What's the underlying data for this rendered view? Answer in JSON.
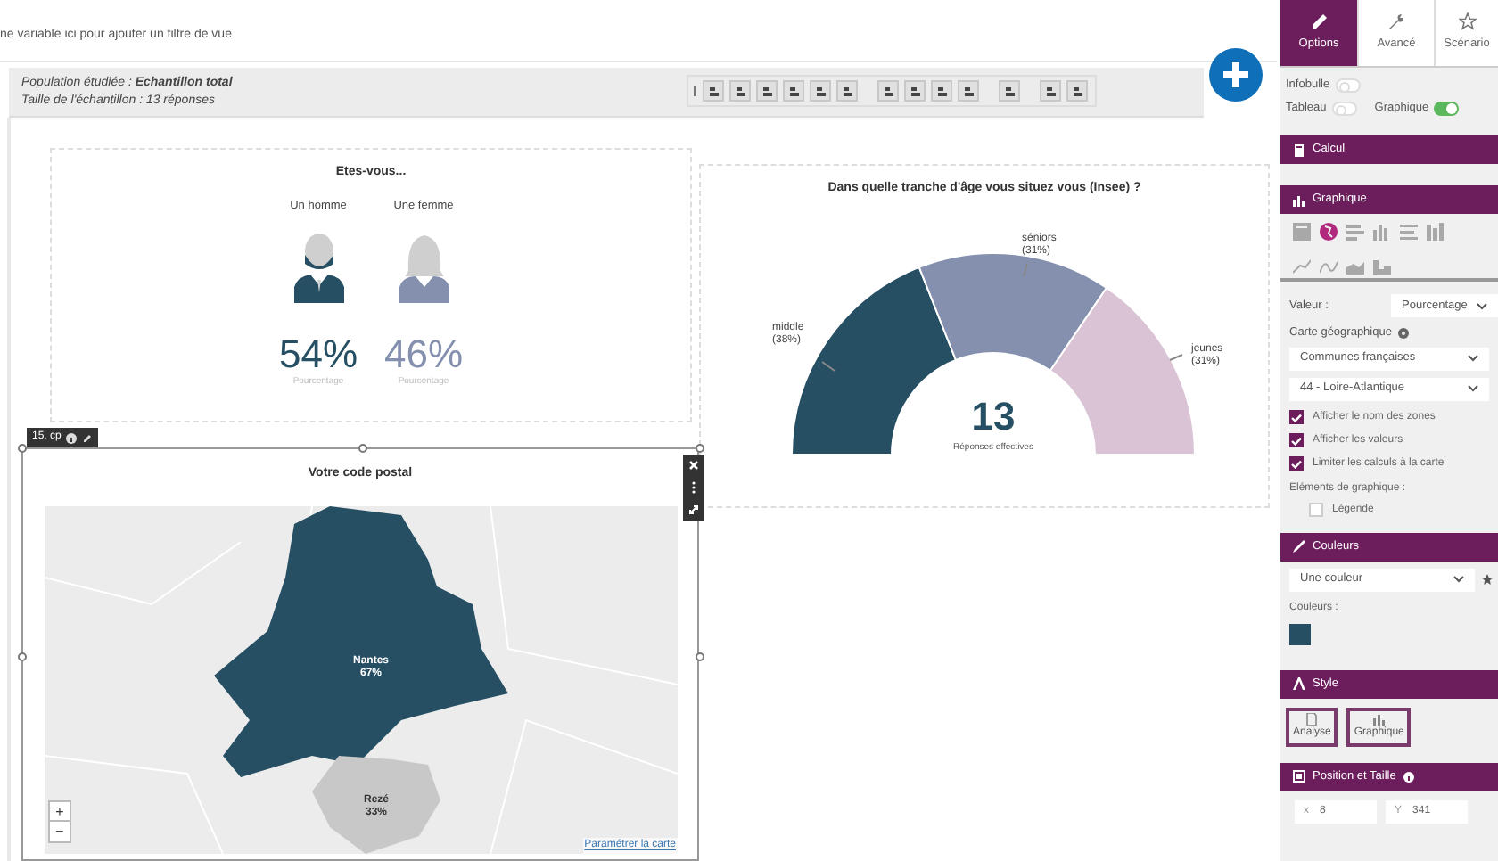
{
  "filter_bar": {
    "placeholder": "ne variable ici pour ajouter un filtre de vue"
  },
  "header": {
    "population_label": "Population étudiée : ",
    "population_value": "Echantillon total",
    "sample_size": "Taille de l'échantillon : 13 réponses"
  },
  "gender_widget": {
    "title": "Etes-vous...",
    "items": [
      {
        "kind": "man",
        "label": "Un homme",
        "value": "54%",
        "caption": "Pourcentage",
        "color": "#264f63"
      },
      {
        "kind": "woman",
        "label": "Une femme",
        "value": "46%",
        "caption": "Pourcentage",
        "color": "#8490ad"
      }
    ]
  },
  "age_widget": {
    "title": "Dans quelle tranche d'âge vous situez vous (Insee) ?",
    "total": "13",
    "total_caption": "Réponses effectives",
    "slice_percentages": [
      "(38%)",
      "(31%)",
      "(31%)"
    ],
    "chart_data": {
      "type": "donut",
      "categories": [
        "middle",
        "séniors",
        "jeunes"
      ],
      "values": [
        38,
        31,
        31
      ],
      "colors": [
        "#264f63",
        "#8490ad",
        "#d9c3d4"
      ]
    }
  },
  "map_widget": {
    "badge": "15. cp",
    "title": "Votre code postal",
    "zones": [
      {
        "name": "Nantes",
        "pct": "67%",
        "color": "#264f63"
      },
      {
        "name": "Rezé",
        "pct": "33%",
        "color": "#c8c8c8"
      }
    ],
    "zoom_in": "+",
    "zoom_out": "−",
    "link": "Paramétrer la carte"
  },
  "sidebar": {
    "tabs": [
      {
        "kind": "pencil",
        "label": "Options",
        "selected": true
      },
      {
        "kind": "wrench",
        "label": "Avancé",
        "selected": false
      },
      {
        "kind": "star",
        "label": "Scénario",
        "selected": false
      }
    ],
    "toggles": [
      {
        "label": "Infobulle",
        "on": false
      },
      {
        "label": "Tableau",
        "on": false
      },
      {
        "label": "Graphique",
        "on": true
      }
    ],
    "calcul_header": "Calcul",
    "graph_header": "Graphique",
    "chart_types": [
      {
        "kind": "table",
        "selected": false
      },
      {
        "kind": "map",
        "selected": true
      },
      {
        "kind": "hbar",
        "selected": false
      },
      {
        "kind": "vbar",
        "selected": false
      },
      {
        "kind": "hlist",
        "selected": false
      },
      {
        "kind": "vstack",
        "selected": false
      },
      {
        "kind": "line",
        "selected": false
      },
      {
        "kind": "spline",
        "selected": false
      },
      {
        "kind": "area",
        "selected": false
      },
      {
        "kind": "step",
        "selected": false
      }
    ],
    "value_label": "Valeur :",
    "value_select": "Pourcentage",
    "map_label": "Carte géographique",
    "map_select": "Communes françaises",
    "dept_select": "44 - Loire-Atlantique",
    "checkboxes": [
      {
        "label": "Afficher le nom des zones",
        "checked": true
      },
      {
        "label": "Afficher les valeurs",
        "checked": true
      },
      {
        "label": "Limiter les calculs à la carte",
        "checked": true
      }
    ],
    "elements_label": "Eléments de graphique :",
    "legend": {
      "label": "Légende",
      "checked": false
    },
    "colors_header": "Couleurs",
    "color_select": "Une couleur",
    "colors_label": "Couleurs :",
    "swatches": [
      {
        "color": "#264f63"
      }
    ],
    "style_header": "Style",
    "style_buttons": [
      {
        "kind": "page",
        "label": "Analyse"
      },
      {
        "kind": "chart",
        "label": "Graphique"
      }
    ],
    "position_header": "Position et Taille",
    "x_label": "x",
    "x_value": "8",
    "y_label": "Y",
    "y_value": "341"
  }
}
